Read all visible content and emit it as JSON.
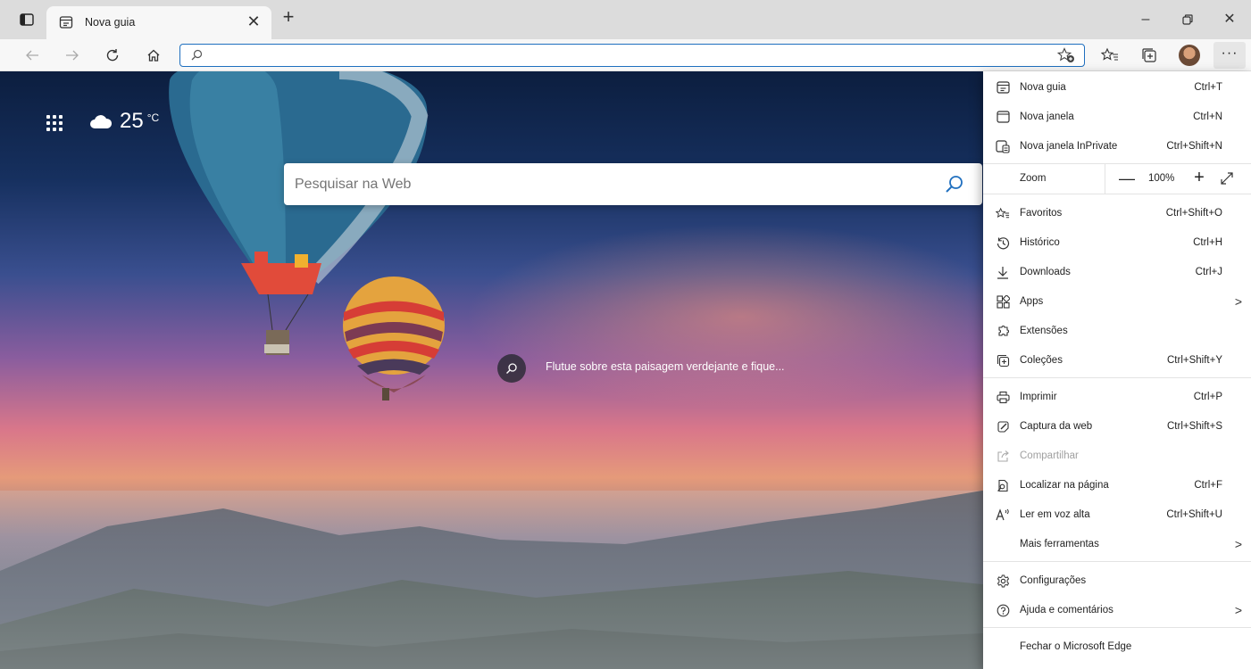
{
  "tab": {
    "title": "Nova guia"
  },
  "address": {
    "value": "",
    "placeholder": ""
  },
  "page": {
    "weather": {
      "temperature": "25",
      "unit": "°C",
      "icon": "cloud-icon"
    },
    "search": {
      "placeholder": "Pesquisar na Web"
    },
    "image_caption": "Flutue sobre esta paisagem verdejante e fique..."
  },
  "menu": {
    "items": [
      {
        "label": "Nova guia",
        "shortcut": "Ctrl+T",
        "icon": "new-tab-icon"
      },
      {
        "label": "Nova janela",
        "shortcut": "Ctrl+N",
        "icon": "new-window-icon"
      },
      {
        "label": "Nova janela InPrivate",
        "shortcut": "Ctrl+Shift+N",
        "icon": "inprivate-icon"
      },
      {
        "label": "Favoritos",
        "shortcut": "Ctrl+Shift+O",
        "icon": "favorites-icon"
      },
      {
        "label": "Histórico",
        "shortcut": "Ctrl+H",
        "icon": "history-icon"
      },
      {
        "label": "Downloads",
        "shortcut": "Ctrl+J",
        "icon": "download-icon"
      },
      {
        "label": "Apps",
        "shortcut": "",
        "icon": "apps-icon",
        "submenu": true
      },
      {
        "label": "Extensões",
        "shortcut": "",
        "icon": "extensions-icon"
      },
      {
        "label": "Coleções",
        "shortcut": "Ctrl+Shift+Y",
        "icon": "collections-icon"
      },
      {
        "label": "Imprimir",
        "shortcut": "Ctrl+P",
        "icon": "print-icon"
      },
      {
        "label": "Captura da web",
        "shortcut": "Ctrl+Shift+S",
        "icon": "web-capture-icon"
      },
      {
        "label": "Compartilhar",
        "shortcut": "",
        "icon": "share-icon",
        "disabled": true
      },
      {
        "label": "Localizar na página",
        "shortcut": "Ctrl+F",
        "icon": "find-icon"
      },
      {
        "label": "Ler em voz alta",
        "shortcut": "Ctrl+Shift+U",
        "icon": "read-aloud-icon"
      },
      {
        "label": "Mais ferramentas",
        "shortcut": "",
        "icon": "",
        "submenu": true
      },
      {
        "label": "Configurações",
        "shortcut": "",
        "icon": "settings-icon"
      },
      {
        "label": "Ajuda e comentários",
        "shortcut": "",
        "icon": "help-icon",
        "submenu": true
      },
      {
        "label": "Fechar o Microsoft Edge",
        "shortcut": "",
        "icon": ""
      }
    ],
    "zoom": {
      "label": "Zoom",
      "value": "100%",
      "minus": "—",
      "plus": "+"
    }
  }
}
